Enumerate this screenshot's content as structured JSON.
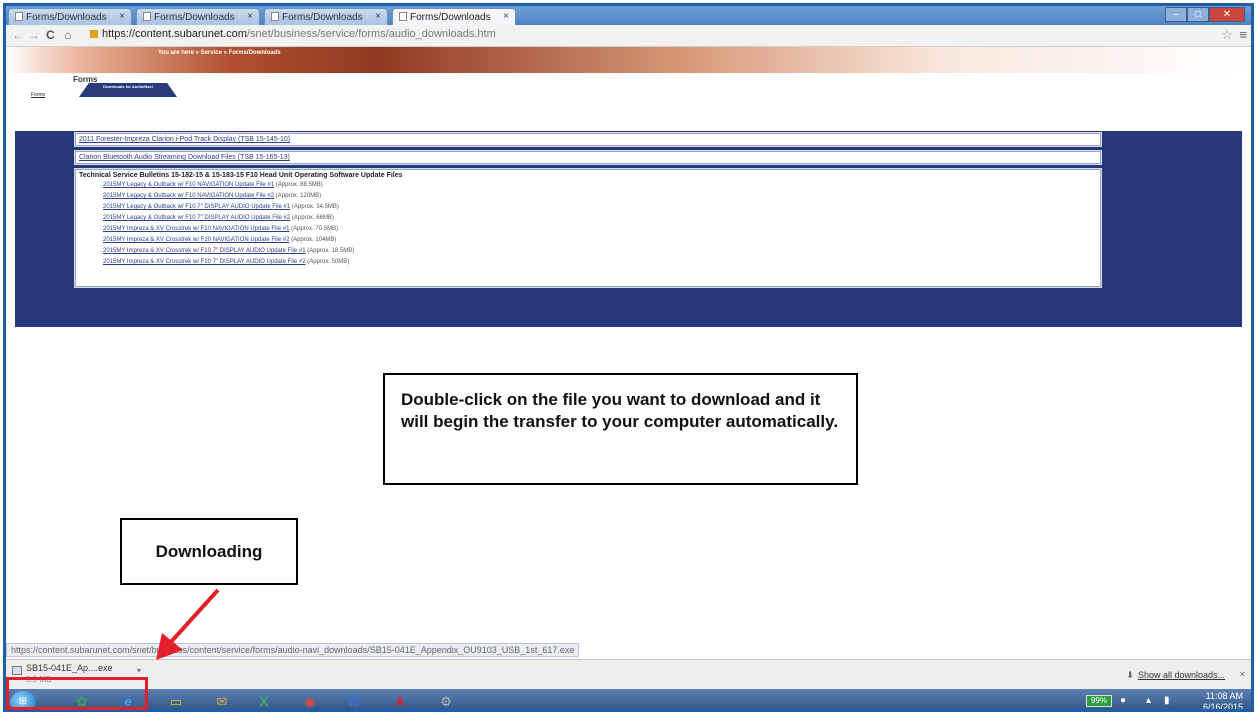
{
  "browser": {
    "tabs": [
      {
        "label": "Forms/Downloads",
        "close": "×"
      },
      {
        "label": "Forms/Downloads",
        "close": "×"
      },
      {
        "label": "Forms/Downloads",
        "close": "×"
      },
      {
        "label": "Forms/Downloads",
        "close": "×"
      }
    ],
    "url_host": "https://content.subarunet.com",
    "url_path": "/snet/business/service/forms/audio_downloads.htm",
    "status_url": "https://content.subarunet.com/snet/business/content/service/forms/audio-navi_downloads/SB15-041E_Appendix_OU9103_USB_1st_617.exe"
  },
  "page": {
    "breadcrumb": "You are here » Service » Forms/Downloads",
    "section_title": "Forms",
    "subtabs": {
      "forms": "Forms",
      "downloads": "Downloads for Audio/Navi"
    },
    "links": [
      "2011 Forester-Impreza Clarion i-Pod Track Display (TSB 15-145-10)",
      "Clarion Bluetooth Audio Streaming Download Files (TSB 15-165-13)"
    ],
    "tsb_title": "Technical Service Bulletins 15-182-15 & 15-183-15 F10 Head Unit Operating Software Update Files",
    "files": [
      {
        "name": "2015MY Legacy & Outback w/ F10 NAVIGATION Update File #1",
        "size": "(Approx. 88.5MB)"
      },
      {
        "name": "2015MY Legacy & Outback w/ F10 NAVIGATION Update File #2",
        "size": "(Approx. 120MB)"
      },
      {
        "name": "2015MY Legacy & Outback w/ F10 7\" DISPLAY AUDIO Update File #1",
        "size": "(Approx. 34.5MB)"
      },
      {
        "name": "2015MY Legacy & Outback w/ F10 7\" DISPLAY AUDIO Update File #2",
        "size": "(Approx. 66MB)"
      },
      {
        "name": "2015MY Impreza & XV Crosstrek w/ F10 NAVIGATION Update File #1",
        "size": "(Approx. 70.5MB)"
      },
      {
        "name": "2015MY Impreza & XV Crosstrek w/ F10 NAVIGATION Update File #2",
        "size": "(Approx. 104MB)"
      },
      {
        "name": "2015MY Impreza & XV Crosstrek w/ F10 7\" DISPLAY AUDIO Update File #1",
        "size": "(Approx. 18.5MB)"
      },
      {
        "name": "2015MY Impreza & XV Crosstrek w/ F10 7\" DISPLAY AUDIO Update File #2",
        "size": "(Approx. 50MB)"
      }
    ]
  },
  "callouts": {
    "main": "Double-click on the file you want to download and it will begin the transfer to your computer automatically.",
    "downloading": "Downloading"
  },
  "download_shelf": {
    "file_name": "SB15-041E_Ap....exe",
    "file_size": "5.9 MB",
    "show_all": "Show all downloads...",
    "close": "×"
  },
  "taskbar": {
    "battery": "99%",
    "time": "11:08 AM",
    "date": "6/16/2015"
  },
  "colors": {
    "page_blue": "#28377a",
    "highlight_red": "#e3202a",
    "window_border": "#1f5fa8"
  }
}
